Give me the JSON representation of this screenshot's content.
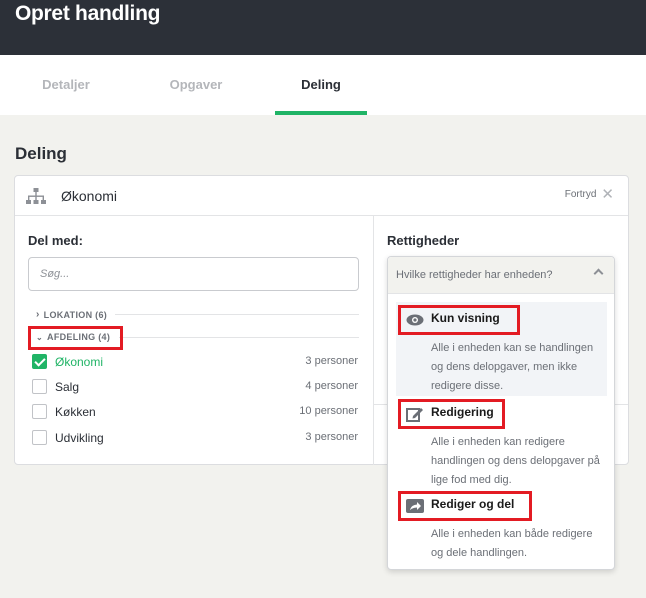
{
  "header": {
    "title": "Opret handling"
  },
  "tabs": [
    {
      "label": "Detaljer",
      "active": false
    },
    {
      "label": "Opgaver",
      "active": false
    },
    {
      "label": "Deling",
      "active": true
    }
  ],
  "section": {
    "title": "Deling"
  },
  "card": {
    "unit_name": "Økonomi",
    "cancel_label": "Fortryd",
    "share_with_label": "Del med:",
    "search_placeholder": "Søg...",
    "groups": [
      {
        "label": "LOKATION (6)",
        "expanded": false
      },
      {
        "label": "AFDELING (4)",
        "expanded": true
      }
    ],
    "items": [
      {
        "name": "Økonomi",
        "count": "3 personer",
        "checked": true
      },
      {
        "name": "Salg",
        "count": "4 personer",
        "checked": false
      },
      {
        "name": "Køkken",
        "count": "10 personer",
        "checked": false
      },
      {
        "name": "Udvikling",
        "count": "3 personer",
        "checked": false
      }
    ],
    "rights_label": "Rettigheder"
  },
  "dropdown": {
    "placeholder": "Hvilke rettigheder har enheden?",
    "options": [
      {
        "name": "Kun visning",
        "icon": "eye-icon",
        "desc": "Alle i enheden kan se handlingen og dens delopgaver, men ikke redigere disse."
      },
      {
        "name": "Redigering",
        "icon": "edit-icon",
        "desc": "Alle i enheden kan redigere handlingen og dens delopgaver på lige fod med dig."
      },
      {
        "name": "Rediger og del",
        "icon": "share-icon",
        "desc": "Alle i enheden kan både redigere og dele handlingen."
      }
    ]
  },
  "colors": {
    "accent": "#20b466",
    "topbar": "#2c3038",
    "highlight": "#e31b23"
  }
}
